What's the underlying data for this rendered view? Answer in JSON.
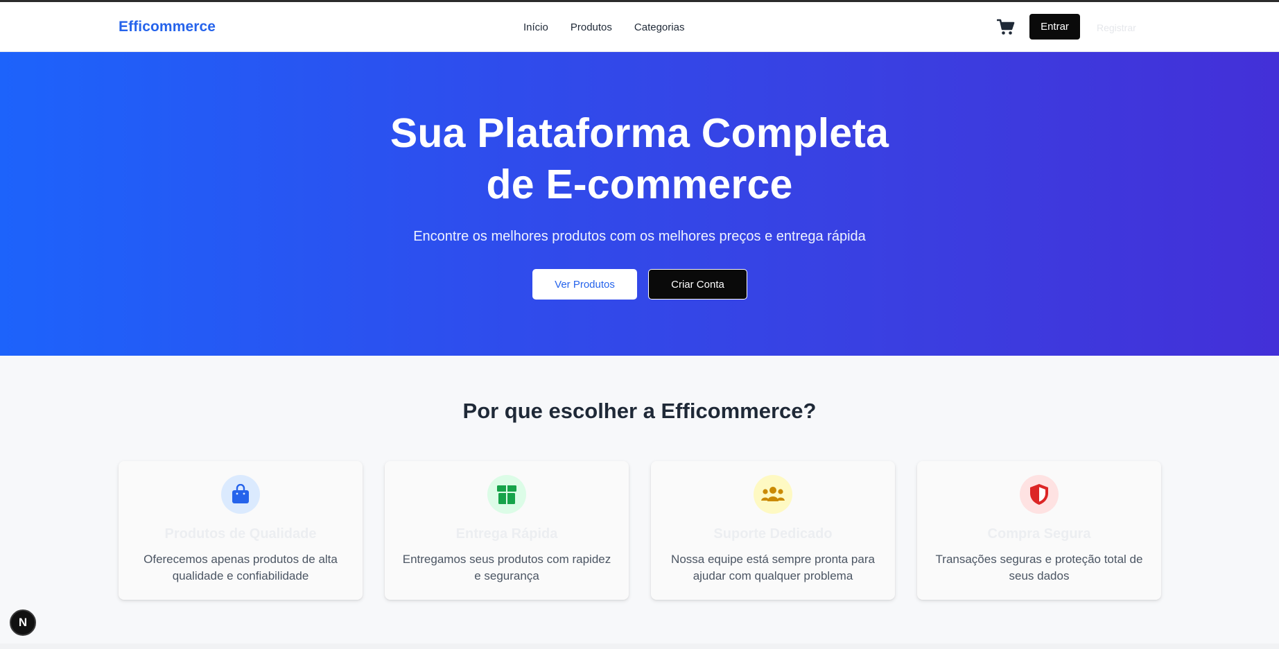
{
  "nav": {
    "brand": "Efficommerce",
    "links": [
      "Início",
      "Produtos",
      "Categorias"
    ],
    "login_label": "Entrar",
    "register_label": "Registrar",
    "cart_icon": "shopping-cart-icon"
  },
  "hero": {
    "title_line1": "Sua Plataforma Completa",
    "title_line2": "de E-commerce",
    "subtitle": "Encontre os melhores produtos com os melhores preços e entrega rápida",
    "primary_button": "Ver Produtos",
    "secondary_button": "Criar Conta"
  },
  "features": {
    "title": "Por que escolher a Efficommerce?",
    "items": [
      {
        "icon": "shopping-bag-icon",
        "title": "Produtos de Qualidade",
        "desc": "Oferecemos apenas produtos de alta qualidade e confiabilidade",
        "color": "#2563eb",
        "bg": "#dbeafe"
      },
      {
        "icon": "box-icon",
        "title": "Entrega Rápida",
        "desc": "Entregamos seus produtos com rapidez e segurança",
        "color": "#16a34a",
        "bg": "#dcfce7"
      },
      {
        "icon": "users-icon",
        "title": "Suporte Dedicado",
        "desc": "Nossa equipe está sempre pronta para ajudar com qualquer problema",
        "color": "#ca8a04",
        "bg": "#fef9c3"
      },
      {
        "icon": "shield-icon",
        "title": "Compra Segura",
        "desc": "Transações seguras e proteção total de seus dados",
        "color": "#dc2626",
        "bg": "#fee2e2"
      }
    ]
  },
  "dev_badge": "N"
}
